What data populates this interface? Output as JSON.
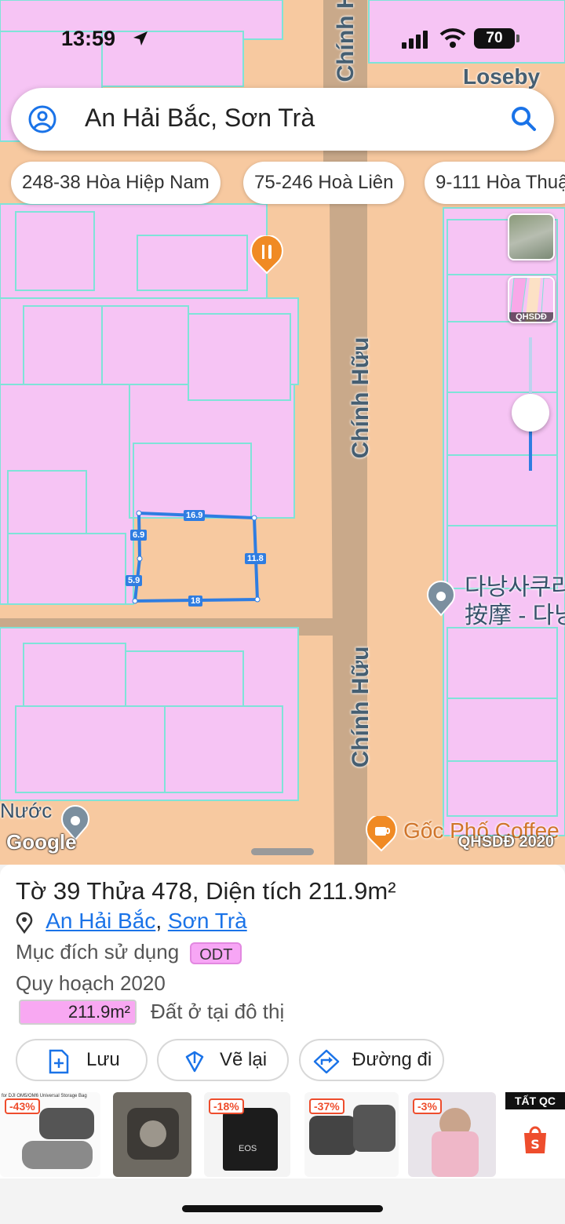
{
  "status": {
    "time": "13:59",
    "battery": "70"
  },
  "search": {
    "query": "An Hải Bắc, Sơn Trà"
  },
  "chips": [
    "248-38 Hòa Hiệp Nam",
    "75-246 Hoà Liên",
    "9-111 Hòa Thuậ"
  ],
  "layers": {
    "planning_tag": "QHSDĐ"
  },
  "map": {
    "street_top_label": "Chính H",
    "street_corner_label": "Loseby",
    "road_labels": [
      "Chính Hữu",
      "Chính Hữu"
    ],
    "poi_korean_line1": "다낭사쿠라",
    "poi_korean_line2": "按摩 - 다낭",
    "poi_left": "Nước",
    "poi_coffee": "Gốc Phố Coffee",
    "google": "Google",
    "layer_badge": "QHSDĐ 2020",
    "parcel_dims": [
      "16.9",
      "6.9",
      "5.9",
      "11.8",
      "18"
    ]
  },
  "parcel": {
    "title": "Tờ 39 Thửa 478, Diện tích 211.9m²",
    "ward": "An Hải Bắc",
    "district": "Sơn Trà",
    "purpose_label": "Mục đích sử dụng",
    "purpose_code": "ODT",
    "plan_label": "Quy hoạch 2020",
    "plan_area": "211.9m²",
    "plan_desc": "Đất ở tại đô thị"
  },
  "actions": {
    "save": "Lưu",
    "redraw": "Vẽ lại",
    "directions": "Đường đi"
  },
  "ads": {
    "item1_caption": "for DJI OM5/OM6 Universal Storage Bag",
    "discounts": [
      "-43%",
      "-18%",
      "-37%",
      "-3%"
    ],
    "all_ads": "TẤT QC"
  },
  "colors": {
    "accent": "#1a73e8",
    "parcel_line": "#2f7de1",
    "land_pink": "#f6c4f4",
    "road_tan": "#f7c9a0"
  }
}
